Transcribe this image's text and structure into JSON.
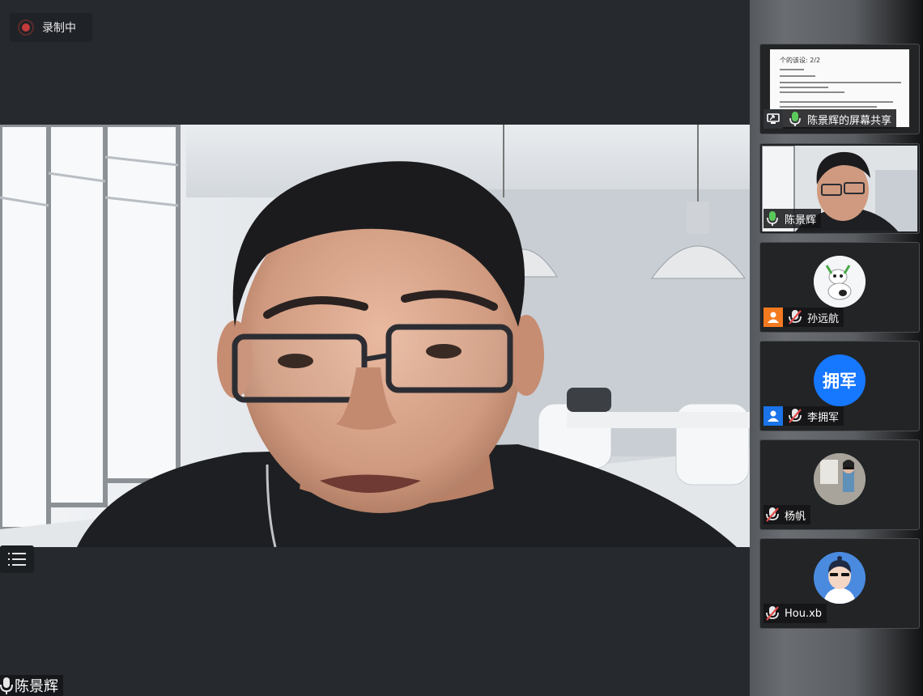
{
  "recording": {
    "label": "录制中"
  },
  "main": {
    "speaker_name": "陈景辉"
  },
  "participants": [
    {
      "name": "陈景辉的屏幕共享",
      "type": "screen-share",
      "mic": "on"
    },
    {
      "name": "陈景辉",
      "type": "video",
      "mic": "on"
    },
    {
      "name": "孙远航",
      "type": "avatar",
      "mic": "muted",
      "badge": "host"
    },
    {
      "name": "李拥军",
      "type": "avatar-text",
      "avatar_text": "拥军",
      "mic": "muted",
      "badge": "co-host"
    },
    {
      "name": "杨帆",
      "type": "avatar",
      "mic": "muted"
    },
    {
      "name": "Hou.xb",
      "type": "avatar",
      "mic": "muted"
    }
  ],
  "screen_share_doc": {
    "heading": "个的该设: 2/2"
  },
  "colors": {
    "host_badge": "#f47a20",
    "cohost_badge": "#1a73e8",
    "avatar_blue": "#1677ff",
    "mic_on": "#5ac85a",
    "mic_muted": "#e04848"
  },
  "icons": [
    "record-icon",
    "list-icon",
    "mic-icon",
    "mic-muted-icon",
    "screen-share-icon",
    "user-badge-icon"
  ]
}
